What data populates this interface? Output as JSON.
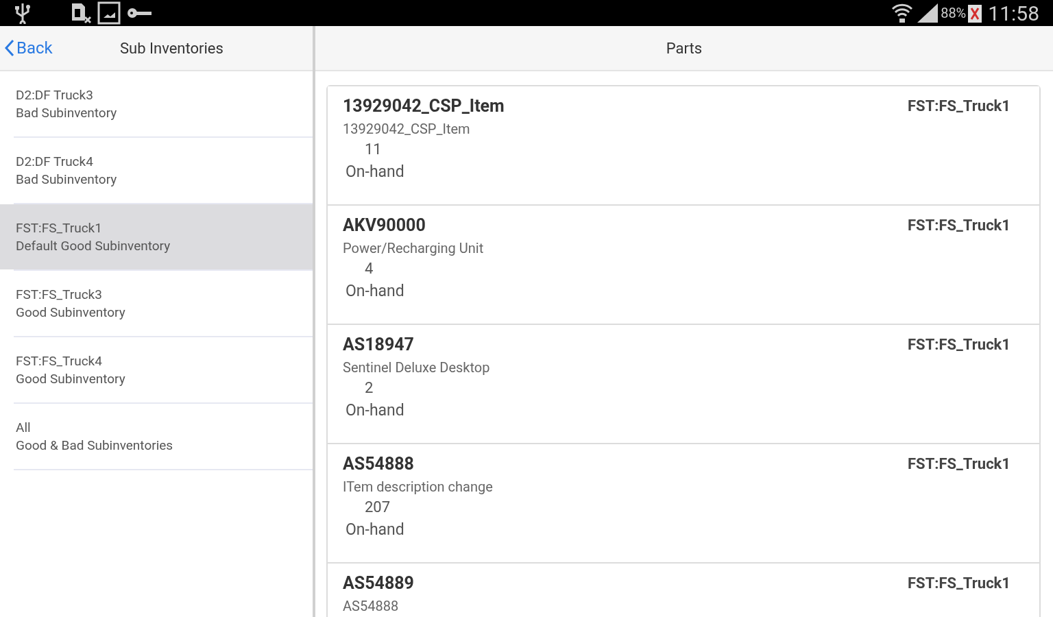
{
  "status_bar": {
    "battery": "88%",
    "time": "11:58"
  },
  "left_panel": {
    "back": "Back",
    "title": "Sub Inventories",
    "items": [
      {
        "name": "D2:DF Truck3",
        "description": "Bad Subinventory",
        "selected": false
      },
      {
        "name": "D2:DF Truck4",
        "description": "Bad Subinventory",
        "selected": false
      },
      {
        "name": "FST:FS_Truck1",
        "description": "Default Good Subinventory",
        "selected": true
      },
      {
        "name": "FST:FS_Truck3",
        "description": "Good Subinventory",
        "selected": false
      },
      {
        "name": "FST:FS_Truck4",
        "description": "Good Subinventory",
        "selected": false
      },
      {
        "name": "All",
        "description": "Good & Bad Subinventories",
        "selected": false
      }
    ]
  },
  "right_panel": {
    "title": "Parts",
    "parts": [
      {
        "number": "13929042_CSP_Item",
        "location": "FST:FS_Truck1",
        "description": "13929042_CSP_Item",
        "quantity": "11",
        "quantity_label": "On-hand"
      },
      {
        "number": "AKV90000",
        "location": "FST:FS_Truck1",
        "description": "Power/Recharging Unit",
        "quantity": "4",
        "quantity_label": "On-hand"
      },
      {
        "number": "AS18947",
        "location": "FST:FS_Truck1",
        "description": "Sentinel Deluxe Desktop",
        "quantity": "2",
        "quantity_label": "On-hand"
      },
      {
        "number": "AS54888",
        "location": "FST:FS_Truck1",
        "description": "ITem description change",
        "quantity": "207",
        "quantity_label": "On-hand"
      },
      {
        "number": "AS54889",
        "location": "FST:FS_Truck1",
        "description": "AS54888"
      }
    ]
  }
}
